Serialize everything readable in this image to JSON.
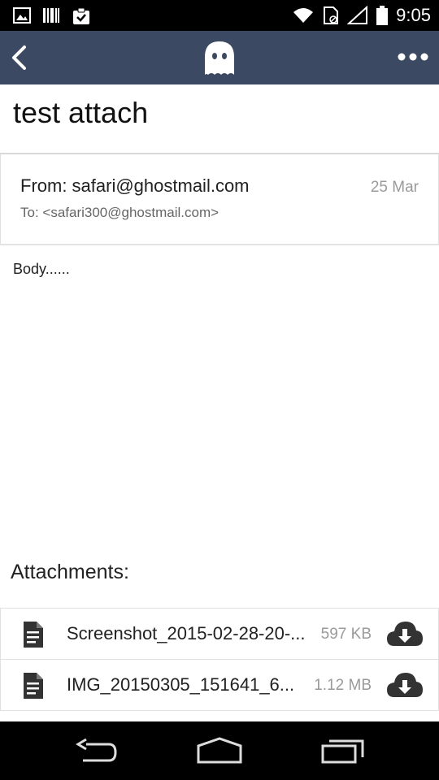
{
  "status_bar": {
    "time": "9:05",
    "icons": [
      "image-icon",
      "barcode-icon",
      "clipboard-check-icon",
      "wifi-icon",
      "sim-icon",
      "signal-icon",
      "battery-icon"
    ]
  },
  "app_bar": {
    "back_icon": "chevron-left-icon",
    "logo_icon": "ghost-icon",
    "menu_icon": "more-dots-icon",
    "background": "#3b4a62"
  },
  "message": {
    "subject": "test attach",
    "from": "From: safari@ghostmail.com",
    "date": "25 Mar",
    "to": "To: <safari300@ghostmail.com>",
    "body": "Body......"
  },
  "attachments": {
    "title": "Attachments:",
    "items": [
      {
        "name": "Screenshot_2015-02-28-20-...",
        "size": "597 KB"
      },
      {
        "name": "IMG_20150305_151641_6...",
        "size": "1.12 MB"
      }
    ]
  },
  "nav_bar": {
    "icons": [
      "back-nav-icon",
      "home-nav-icon",
      "recents-nav-icon"
    ]
  }
}
